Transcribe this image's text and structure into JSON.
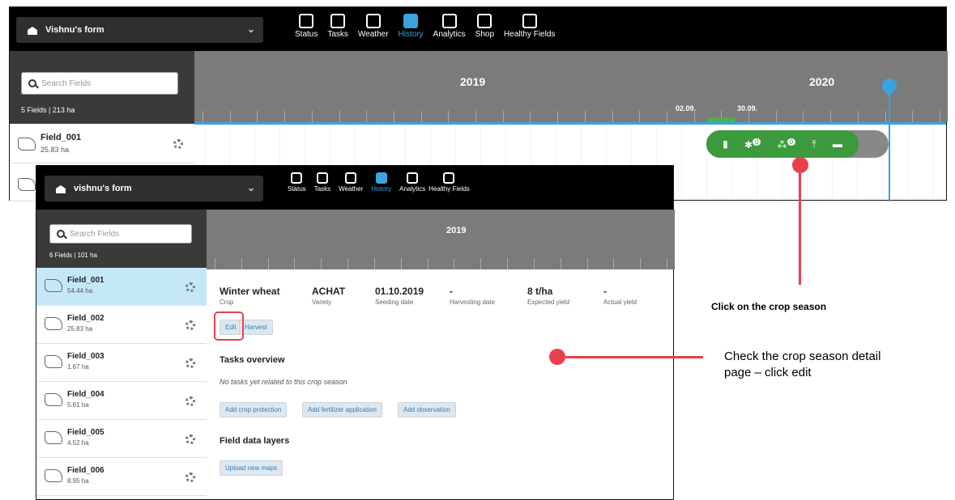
{
  "screen1": {
    "farm_name": "Vishnu's form",
    "nav": [
      "Status",
      "Tasks",
      "Weather",
      "History",
      "Analytics",
      "Shop",
      "Healthy Fields"
    ],
    "active_nav": "History",
    "search_placeholder": "Search Fields",
    "fields_count": "5 Fields | 213 ha",
    "years": [
      "2019",
      "2020"
    ],
    "dates": [
      "02.09.",
      "30.09."
    ],
    "field": {
      "name": "Field_001",
      "size": "25.83 ha"
    },
    "crop_badges": [
      "0",
      "0"
    ]
  },
  "screen2": {
    "farm_name": "vishnu's form",
    "nav": [
      "Status",
      "Tasks",
      "Weather",
      "History",
      "Analytics",
      "Healthy Fields"
    ],
    "active_nav": "History",
    "search_placeholder": "Search Fields",
    "fields_count": "6 Fields | 101 ha",
    "year": "2019",
    "fields": [
      {
        "name": "Field_001",
        "size": "54.44 ha"
      },
      {
        "name": "Field_002",
        "size": "25.83 ha"
      },
      {
        "name": "Field_003",
        "size": "1.67 ha"
      },
      {
        "name": "Field_004",
        "size": "5.61 ha"
      },
      {
        "name": "Field_005",
        "size": "4.52 ha"
      },
      {
        "name": "Field_006",
        "size": "8.95 ha"
      }
    ],
    "crop_season": {
      "crop": {
        "value": "Winter wheat",
        "label": "Crop"
      },
      "variety": {
        "value": "ACHAT",
        "label": "Variety"
      },
      "seeding": {
        "value": "01.10.2019",
        "label": "Seeding date"
      },
      "harvesting": {
        "value": "-",
        "label": "Harvesting date"
      },
      "expected": {
        "value": "8 t/ha",
        "label": "Expected yield"
      },
      "actual": {
        "value": "-",
        "label": "Actual yield"
      }
    },
    "edit_label": "Edit",
    "harvest_label": "Harvest",
    "tasks_title": "Tasks overview",
    "no_tasks": "No tasks yet related to this crop season",
    "task_buttons": [
      "Add crop protection",
      "Add fertilizer application",
      "Add observation"
    ],
    "layers_title": "Field data layers",
    "upload_label": "Upload new maps"
  },
  "annotations": {
    "step1": "Click on the crop season",
    "step2_line1": "Check the crop season detail",
    "step2_line2": "page – click edit",
    "color": "#e8414d"
  }
}
